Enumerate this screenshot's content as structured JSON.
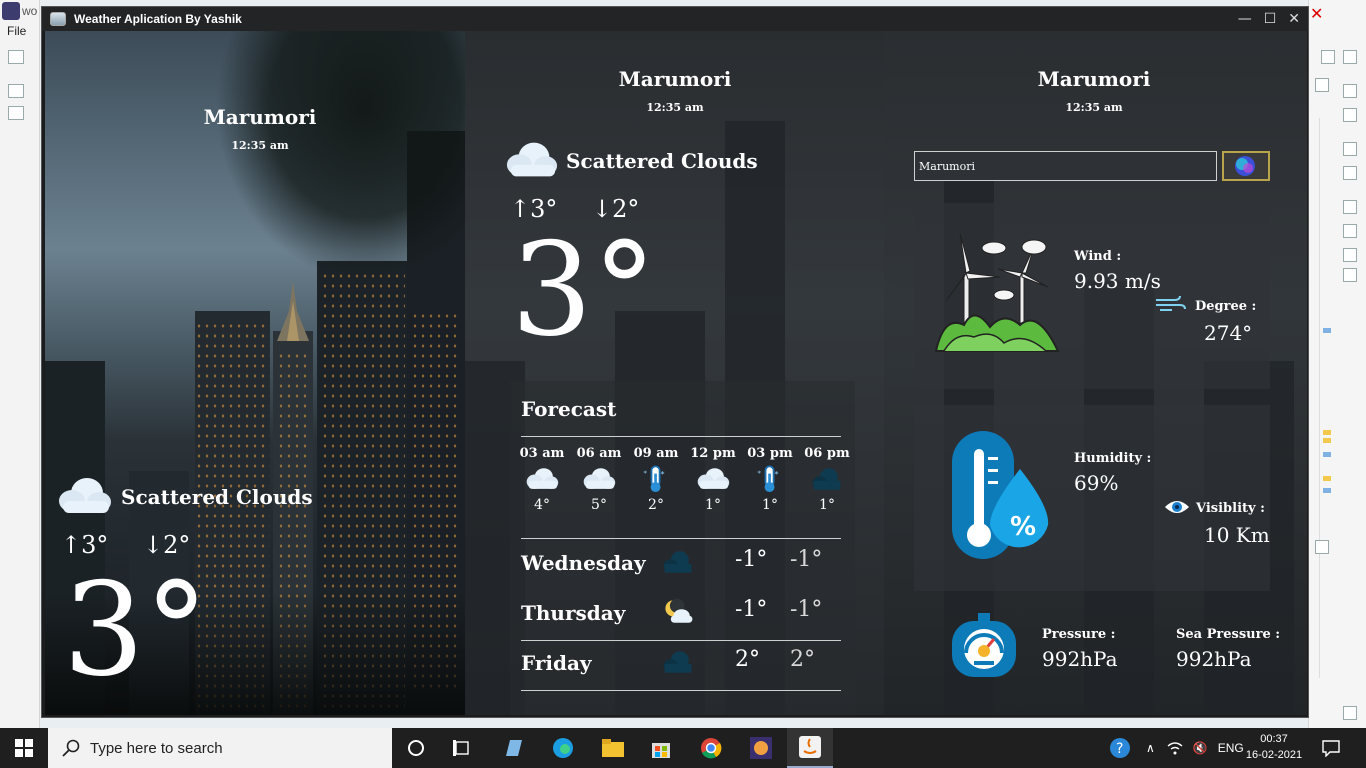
{
  "ide": {
    "window_label": "wo",
    "menu_file": "File"
  },
  "window": {
    "title": "Weather Aplication By Yashik",
    "minimize": "—",
    "maximize": "☐",
    "close": "✕"
  },
  "panel_left": {
    "city": "Marumori",
    "time": "12:35 am",
    "condition": "Scattered Clouds",
    "high": "↑3°",
    "low": "↓2°",
    "temp": "3°"
  },
  "panel_center": {
    "city": "Marumori",
    "time": "12:35 am",
    "condition": "Scattered Clouds",
    "high": "↑3°",
    "low": "↓2°",
    "temp": "3°",
    "forecast": {
      "title": "Forecast",
      "hourly": [
        {
          "time": "03 am",
          "icon": "cloud-icon",
          "temp": "4°"
        },
        {
          "time": "06 am",
          "icon": "cloud-icon",
          "temp": "5°"
        },
        {
          "time": "09 am",
          "icon": "thermometer-cold-icon",
          "temp": "2°"
        },
        {
          "time": "12 pm",
          "icon": "cloud-icon",
          "temp": "1°"
        },
        {
          "time": "03 pm",
          "icon": "thermometer-cold-icon",
          "temp": "1°"
        },
        {
          "time": "06 pm",
          "icon": "dark-cloud-icon",
          "temp": "1°"
        }
      ],
      "daily": [
        {
          "day": "Wednesday",
          "icon": "dark-cloud-icon",
          "hi": "-1°",
          "lo": "-1°"
        },
        {
          "day": "Thursday",
          "icon": "moon-cloud-icon",
          "hi": "-1°",
          "lo": "-1°"
        },
        {
          "day": "Friday",
          "icon": "dark-cloud-icon",
          "hi": "2°",
          "lo": "2°"
        }
      ]
    }
  },
  "panel_right": {
    "city": "Marumori",
    "time": "12:35 am",
    "search_value": "Marumori",
    "wind_label": "Wind :",
    "wind_value": "9.93 m/s",
    "degree_label": "Degree :",
    "degree_value": "274°",
    "humidity_label": "Humidity :",
    "humidity_value": "69%",
    "visibility_label": "Visiblity :",
    "visibility_value": "10 Km",
    "pressure_label": "Pressure :",
    "pressure_value": "992hPa",
    "sea_pressure_label": "Sea Pressure :",
    "sea_pressure_value": "992hPa"
  },
  "taskbar": {
    "search_placeholder": "Type here to search",
    "language": "ENG",
    "clock_time": "00:37",
    "clock_date": "16-02-2021"
  },
  "colors": {
    "window_bg": "#1a1c1e",
    "accent_blue": "#0d8fd6",
    "taskbar": "#1f1f1f"
  }
}
